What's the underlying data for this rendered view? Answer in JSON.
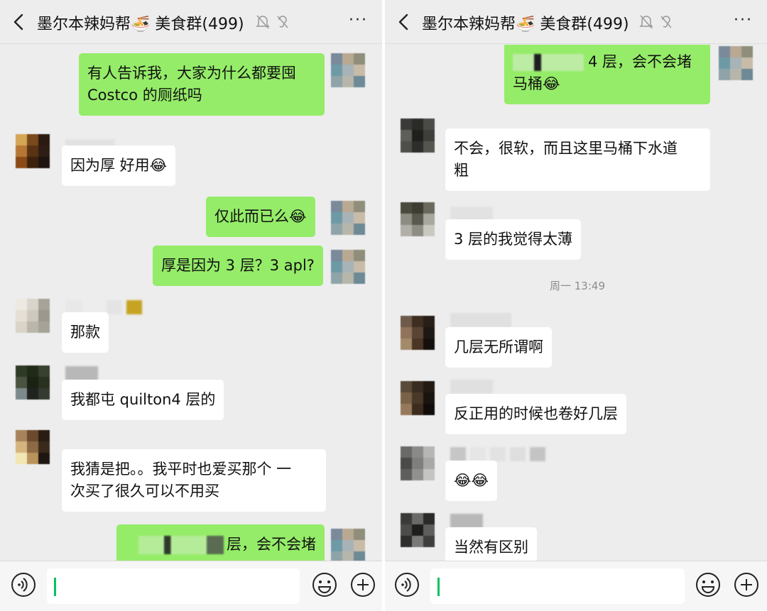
{
  "header": {
    "title": "墨尔本辣妈帮🍜 美食群(499)",
    "more": "···"
  },
  "left_chat": {
    "m1": {
      "line1": "有人告诉我，大家为什么都要囤",
      "line2": "Costco 的厕纸吗"
    },
    "m2": "因为厚 好用😂",
    "m3": "仅此而已么😂",
    "m4": "厚是因为 3 层？3 apl?",
    "m5": "那款",
    "m6": "我都屯 quilton4 层的",
    "m7": {
      "line1": "我猜是把。。我平时也爱买那个 一",
      "line2": "次买了很久可以不用买"
    },
    "m8_partial": "层，会不会堵"
  },
  "right_chat": {
    "r1": {
      "line1": "4 层，会不会堵",
      "line2": "马桶😂"
    },
    "r2": {
      "line1": "不会，很软，而且这里马桶下水道",
      "line2": "粗"
    },
    "r3": "3 层的我觉得太薄",
    "time": "周一 13:49",
    "r4": "几层无所谓啊",
    "r5": "反正用的时候也卷好几层",
    "r6": "😂😂",
    "r7": "当然有区别"
  },
  "colors": {
    "outgoing_bubble": "#95ec69",
    "incoming_bubble": "#ffffff",
    "background": "#ededed",
    "caret": "#07c160"
  },
  "icons": [
    "back-arrow-icon",
    "mute-bell-icon",
    "ear-icon",
    "more-icon",
    "voice-icon",
    "emoji-icon",
    "plus-icon"
  ]
}
